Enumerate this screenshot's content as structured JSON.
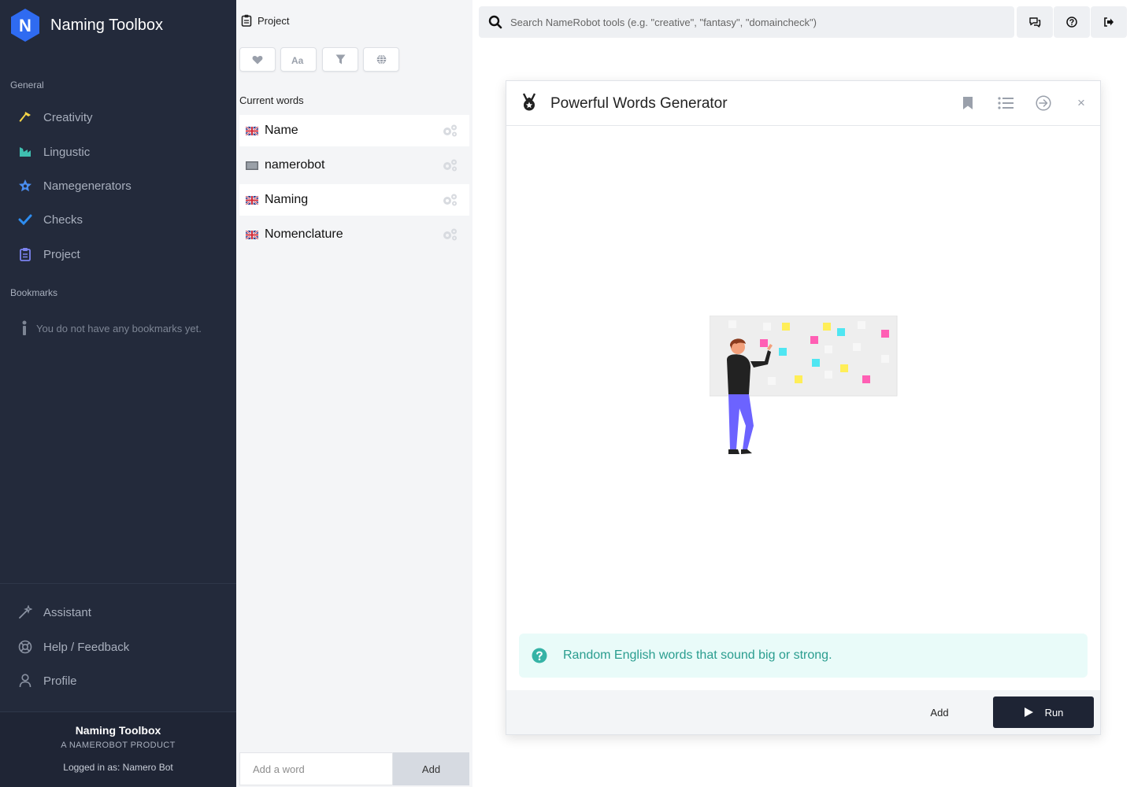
{
  "sidebar": {
    "brand_letter": "N",
    "brand_title": "Naming Toolbox",
    "general_label": "General",
    "nav": [
      {
        "label": "Creativity",
        "icon": "hammer-icon"
      },
      {
        "label": "Lingustic",
        "icon": "chart-icon"
      },
      {
        "label": "Namegenerators",
        "icon": "star-badge-icon"
      },
      {
        "label": "Checks",
        "icon": "check-icon"
      },
      {
        "label": "Project",
        "icon": "clipboard-icon"
      }
    ],
    "bookmarks_label": "Bookmarks",
    "bookmarks_empty": "You do not have any bookmarks yet.",
    "bottom_nav": [
      {
        "label": "Assistant",
        "icon": "magic-wand-icon"
      },
      {
        "label": "Help / Feedback",
        "icon": "lifebuoy-icon"
      },
      {
        "label": "Profile",
        "icon": "user-icon"
      }
    ],
    "footer": {
      "title": "Naming Toolbox",
      "subtitle": "A NAMEROBOT PRODUCT",
      "logged_in": "Logged in as: Namero Bot"
    }
  },
  "project": {
    "header": "Project",
    "tools": [
      "heart-icon",
      "font-case-icon",
      "filter-icon",
      "globe-icon"
    ],
    "current_label": "Current words",
    "words": [
      {
        "text": "Name",
        "flag": "uk-flag"
      },
      {
        "text": "namerobot",
        "flag": "neutral-flag"
      },
      {
        "text": "Naming",
        "flag": "uk-flag"
      },
      {
        "text": "Nomenclature",
        "flag": "uk-flag"
      }
    ],
    "add_placeholder": "Add a word",
    "add_label": "Add"
  },
  "search": {
    "placeholder": "Search NameRobot tools (e.g. \"creative\", \"fantasy\", \"domaincheck\")"
  },
  "modal": {
    "title": "Powerful Words Generator",
    "info": "Random English words that sound big or strong.",
    "add_label": "Add",
    "run_label": "Run",
    "close": "×"
  },
  "colors": {
    "sidebar_bg": "#232a3b",
    "brand_blue": "#2f6bf1",
    "info_bg": "#e9fbf9",
    "info_text": "#2a9d8f",
    "run_bg": "#1e2434"
  }
}
